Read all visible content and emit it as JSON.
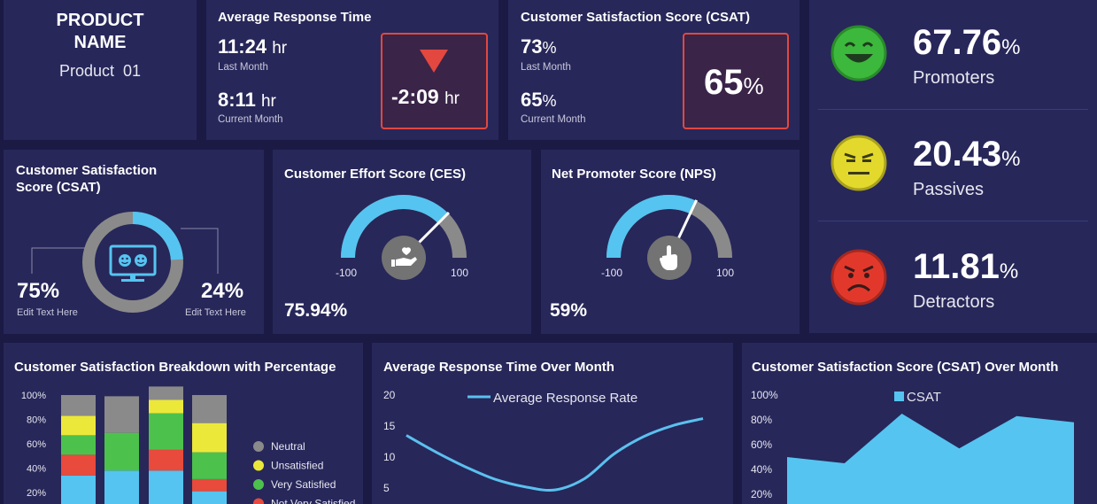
{
  "product": {
    "title_line1": "PRODUCT",
    "title_line2": "NAME",
    "name": "Product  01"
  },
  "avg_response": {
    "title": "Average Response Time",
    "last_value": "11:24",
    "last_unit": "hr",
    "last_label": "Last Month",
    "current_value": "8:11",
    "current_unit": "hr",
    "current_label": "Current Month",
    "delta_value": "-2:09",
    "delta_unit": "hr"
  },
  "csat_top": {
    "title": "Customer Satisfaction Score (CSAT)",
    "last_value": "73",
    "last_unit": "%",
    "last_label": "Last Month",
    "current_value": "65",
    "current_unit": "%",
    "current_label": "Current Month",
    "box_value": "65",
    "box_unit": "%"
  },
  "nps_breakdown": [
    {
      "value": "67.76",
      "unit": "%",
      "label": "Promoters",
      "icon": "happy-face-icon",
      "color": "#3cb83c"
    },
    {
      "value": "20.43",
      "unit": "%",
      "label": "Passives",
      "icon": "neutral-face-icon",
      "color": "#e2d92c"
    },
    {
      "value": "11.81",
      "unit": "%",
      "label": "Detractors",
      "icon": "sad-face-icon",
      "color": "#e2382c"
    }
  ],
  "csat_donut": {
    "title_line1": "Customer Satisfaction",
    "title_line2": "Score (CSAT)",
    "left_value": "75%",
    "left_label": "Edit Text Here",
    "right_value": "24%",
    "right_label": "Edit Text Here",
    "blue_fraction": 0.24,
    "icon": "monitor-smiley-icon"
  },
  "ces": {
    "title": "Customer Effort Score (CES)",
    "min": "-100",
    "max": "100",
    "value": "75.94%",
    "gauge_fraction": 0.75,
    "icon": "hand-heart-icon"
  },
  "nps": {
    "title": "Net Promoter Score (NPS)",
    "min": "-100",
    "max": "100",
    "value": "59%",
    "gauge_fraction": 0.64,
    "icon": "pointer-hand-icon"
  },
  "breakdown": {
    "title": "Customer Satisfaction Breakdown with Percentage",
    "y_ticks": [
      "100%",
      "80%",
      "60%",
      "40%",
      "20%"
    ],
    "legend": [
      {
        "label": "Neutral",
        "color": "#8a8a8a"
      },
      {
        "label": "Unsatisfied",
        "color": "#ece83a"
      },
      {
        "label": "Very Satisfied",
        "color": "#4cc24c"
      },
      {
        "label": "Not Very Satisfied",
        "color": "#e84a3c"
      }
    ]
  },
  "avg_response_chart": {
    "title": "Average Response Time Over Month",
    "legend": "Average Response Rate",
    "y_ticks": [
      "20",
      "15",
      "10",
      "5"
    ],
    "color": "#5bc0ee"
  },
  "csat_chart": {
    "title": "Customer Satisfaction Score (CSAT) Over Month",
    "legend": "CSAT",
    "y_ticks": [
      "100%",
      "80%",
      "60%",
      "40%",
      "20%"
    ],
    "color": "#55c4f0"
  },
  "chart_data": [
    {
      "type": "bar",
      "stacked": true,
      "title": "Customer Satisfaction Breakdown with Percentage",
      "ylim": [
        0,
        100
      ],
      "series": [
        {
          "name": "Not Very Satisfied",
          "values": [
            17,
            0,
            17,
            10
          ]
        },
        {
          "name": "Very Satisfied",
          "values": [
            16,
            31,
            30,
            22
          ]
        },
        {
          "name": "Unsatisfied",
          "values": [
            16,
            0,
            11,
            24
          ]
        },
        {
          "name": "Neutral",
          "values": [
            17,
            30,
            11,
            23
          ]
        }
      ],
      "base_values": [
        34,
        38,
        38,
        21
      ]
    },
    {
      "type": "line",
      "title": "Average Response Time Over Month",
      "ylim": [
        0,
        20
      ],
      "series": [
        {
          "name": "Average Response Rate",
          "x": [
            0,
            1,
            2,
            3,
            4,
            5,
            6,
            7,
            8,
            9,
            10
          ],
          "values": [
            13.5,
            10.8,
            8.4,
            6.4,
            5.2,
            4.7,
            6.5,
            10.5,
            13.3,
            15.1,
            16.2
          ]
        }
      ]
    },
    {
      "type": "area",
      "title": "Customer Satisfaction Score (CSAT) Over Month",
      "ylim": [
        0,
        100
      ],
      "series": [
        {
          "name": "CSAT",
          "values": [
            50,
            45,
            85,
            57,
            83,
            78
          ]
        }
      ]
    }
  ]
}
